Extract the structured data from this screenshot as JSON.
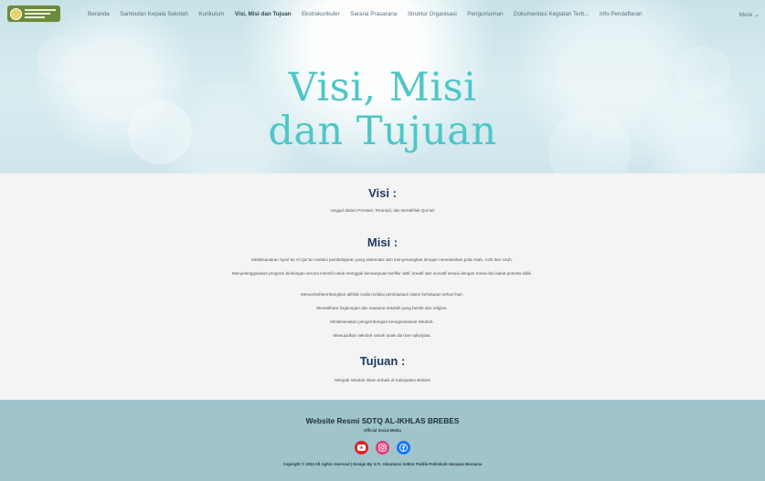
{
  "nav": {
    "items": [
      {
        "label": "Beranda",
        "active": false
      },
      {
        "label": "Sambutan Kepala Sekolah",
        "active": false
      },
      {
        "label": "Kurikulum",
        "active": false
      },
      {
        "label": "Visi, Misi dan Tujuan",
        "active": true
      },
      {
        "label": "Ekstrakurikuler",
        "active": false
      },
      {
        "label": "Sarana Prasarana",
        "active": false
      },
      {
        "label": "Struktur Organisasi",
        "active": false
      },
      {
        "label": "Pengumuman",
        "active": false
      },
      {
        "label": "Dokumentasi Kegiatan Terb...",
        "active": false
      },
      {
        "label": "Info Pendaftaran",
        "active": false
      }
    ],
    "more_label": "More",
    "logo_icon": "school-logo"
  },
  "hero": {
    "title_line1": "Visi, Misi",
    "title_line2": "dan Tujuan",
    "title_color": "#4fc6c7"
  },
  "visi": {
    "heading": "Visi :",
    "text": "Unggul dalam Prestasi, Terampil, dan Berakhlak Qur'ani"
  },
  "misi": {
    "heading": "Misi :",
    "items": [
      "Melaksanakan Syiar ke Al-Qur'an melalui pembelajaran yang sistematis dan menyenangkan dengan menekankan pola Asah, Asih dan Asuh.",
      "Menyelenggarakan program bimbingan secara intensif untuk menggali kemampuan berfikir aktif, kreatif dan inovatif sesuai dengan minat dan bakat peserta didik.",
      "Menumbuhkembangkan akhlak mulia melalui pembiasaan islami kehidupan sehari-hari.",
      "Memelihara lingkungan dan suasana sekolah yang bersih dan religius.",
      "Melaksanakan pengembangan keorganisasian sekolah.",
      "Mewujudkan sekolah ramah anak dan ber-adiwiyata."
    ]
  },
  "tujuan": {
    "heading": "Tujuan :",
    "text": "Menjadi sekolah Islam terbaik di Kabupaten Brebes"
  },
  "footer": {
    "title": "Website Resmi SDTQ AL-IKHLAS BREBES",
    "subtitle": "Official Social Media",
    "socials": [
      "youtube-icon",
      "instagram-icon",
      "facebook-icon"
    ],
    "copyright": "Copiright © 2024 All rights reserved | Design By S.Tr. Akuntansi Sektor Publik-Politeknik Harapan Bersama",
    "bg_color": "#9fc4cb"
  },
  "colors": {
    "heading": "#1f3a63",
    "youtube": "#e02020",
    "instagram": "#e23f78",
    "facebook": "#1877f2"
  }
}
